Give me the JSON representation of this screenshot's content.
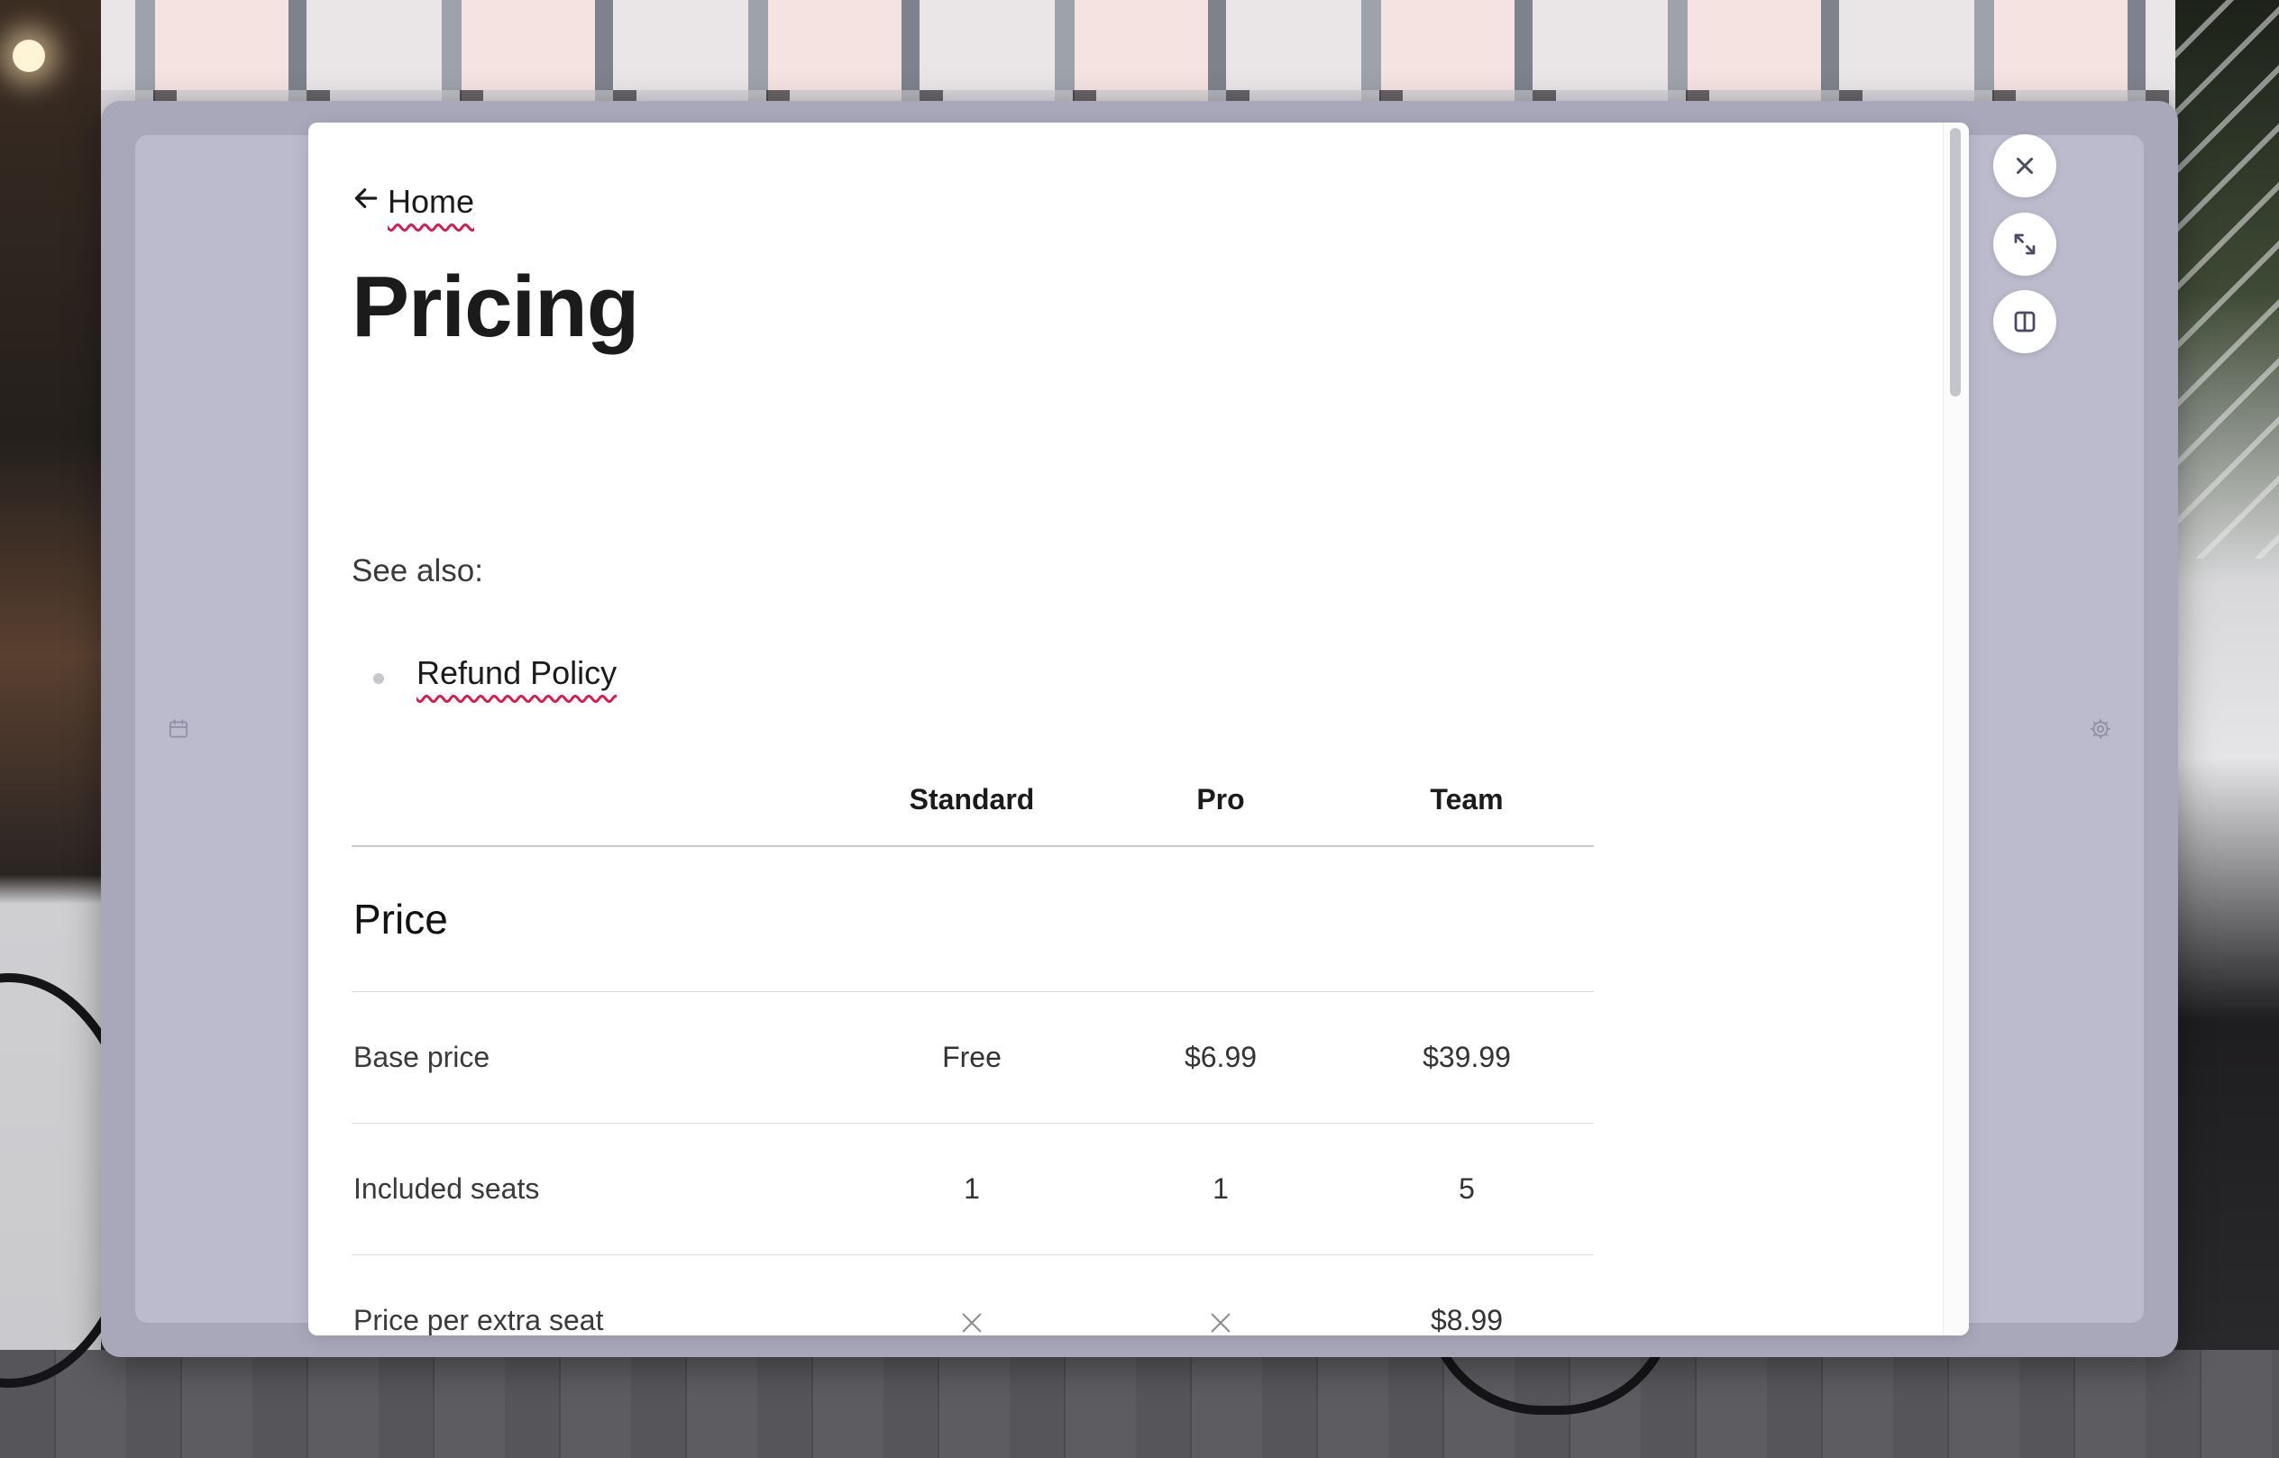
{
  "nav": {
    "back_label": "Home"
  },
  "page": {
    "title": "Pricing",
    "see_also_label": "See also:",
    "links": [
      {
        "label": "Refund Policy"
      }
    ]
  },
  "table": {
    "columns": [
      "Standard",
      "Pro",
      "Team"
    ],
    "sections": [
      {
        "title": "Price",
        "rows": [
          {
            "label": "Base price",
            "values": [
              "Free",
              "$6.99",
              "$39.99"
            ]
          },
          {
            "label": "Included seats",
            "values": [
              "1",
              "1",
              "5"
            ]
          },
          {
            "label": "Price per extra seat",
            "values": [
              null,
              null,
              "$8.99"
            ]
          }
        ]
      }
    ]
  },
  "controls": [
    "close-icon",
    "expand-icon",
    "split-view-icon"
  ],
  "side_icons": {
    "left": "calendar-icon",
    "right": "gear-icon"
  },
  "colors": {
    "frame": "#a9a8bb",
    "frame_inner": "#bcbbcd",
    "link_underline": "#d81b50",
    "card": "#ffffff",
    "control_icon": "#4a4a66"
  }
}
